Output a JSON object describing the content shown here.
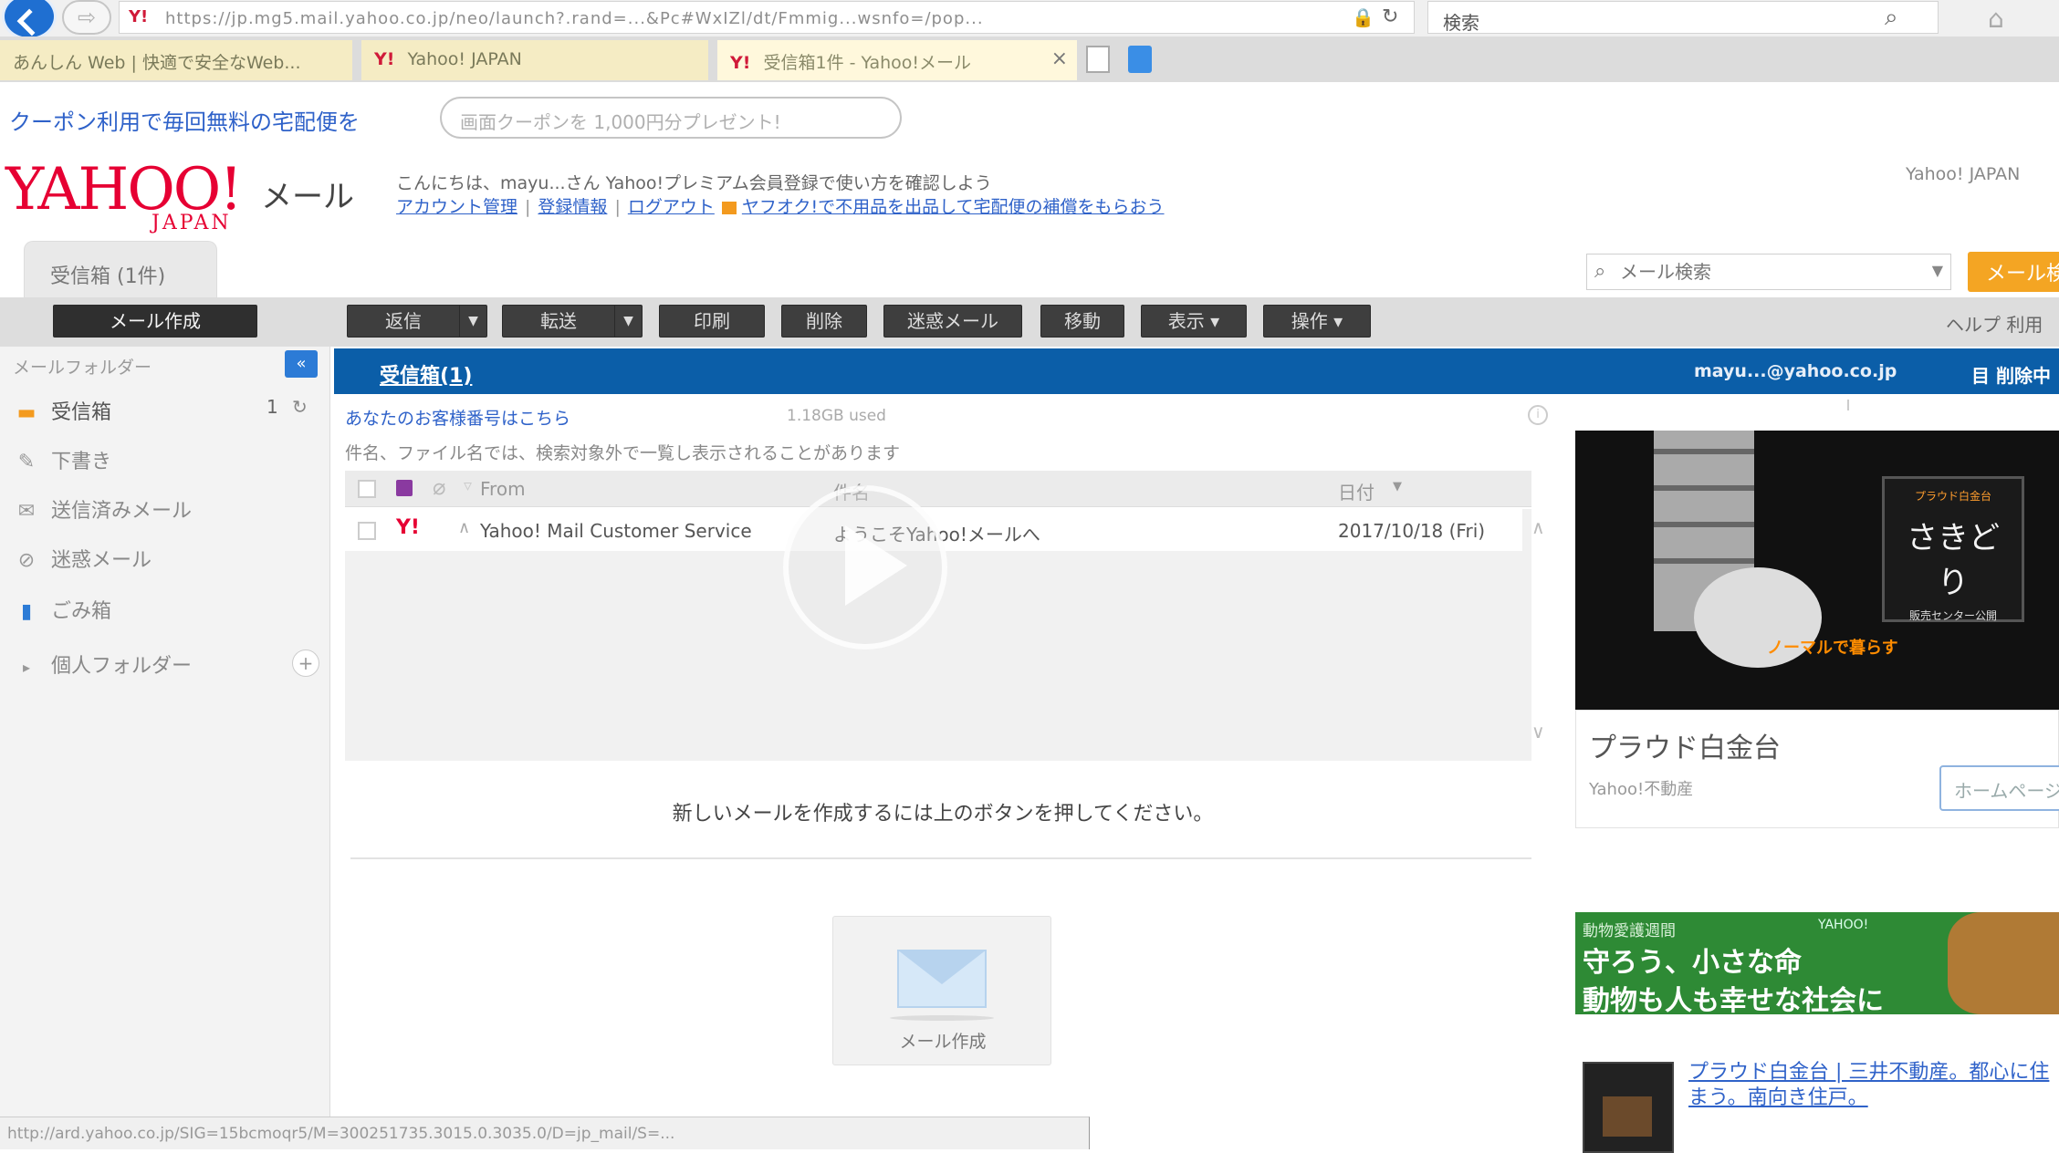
{
  "browser": {
    "back_icon": "back-arrow-icon",
    "forward_icon": "forward-arrow-icon",
    "forward_glyph": "⇨",
    "url_favicon": "Y!",
    "url": "https://jp.mg5.mail.yahoo.co.jp/neo/launch?.rand=...&Pc#WxIZl/dt/Fmmig...wsnfo=/pop...",
    "search_value": "検索",
    "search_icon": "magnifier-icon",
    "tabs": [
      {
        "label": "あんしん Web | 快適で安全なWeb..."
      },
      {
        "favicon": "Y!",
        "label": "Yahoo! JAPAN"
      },
      {
        "favicon": "Y!",
        "label": "受信箱1件 - Yahoo!メール"
      }
    ],
    "tab_close": "×"
  },
  "promo": {
    "link": "クーポン利用で毎回無料の宅配便を",
    "pill": "画面クーポンを 1,000円分プレゼント!"
  },
  "header": {
    "logo_main": "YAHOO!",
    "logo_sub": "JAPAN",
    "app_name": "メール",
    "greeting": "こんにちは、mayu...さん Yahoo!プレミアム会員登録で使い方を確認しよう",
    "links": [
      "アカウント管理",
      "登録情報",
      "ログアウト",
      "ヤフオク!で不用品を出品して宅配便の補償をもらおう"
    ],
    "yahoo_japan": "Yahoo! JAPAN"
  },
  "folder_tab": "受信箱 (1件)",
  "mail_search": {
    "placeholder": "メール検索",
    "button": "メール検索"
  },
  "toolbar": {
    "compose": "メール作成",
    "buttons": [
      "返信",
      "転送",
      "印刷",
      "削除",
      "迷惑メール",
      "移動",
      "表示",
      "操作"
    ],
    "right": "ヘルプ 利用"
  },
  "sidebar": {
    "header": "メールフォルダー",
    "collapse": "«",
    "items": [
      {
        "label": "受信箱",
        "icon": "inbox-icon",
        "glyph": "▬"
      },
      {
        "label": "下書き",
        "icon": "draft-icon",
        "glyph": "✎"
      },
      {
        "label": "送信済みメール",
        "icon": "sent-mail-icon",
        "glyph": "✉"
      },
      {
        "label": "迷惑メール",
        "icon": "spam-icon",
        "glyph": "⊘"
      },
      {
        "label": "ごみ箱",
        "icon": "trash-icon",
        "glyph": "▮"
      },
      {
        "label": "個人フォルダー",
        "icon": "folder-expand-icon",
        "glyph": "▸"
      }
    ],
    "inbox_count": "1",
    "refresh_glyph": "↻",
    "add_glyph": "+"
  },
  "main": {
    "title": "受信箱(1)",
    "account": "mayu...@yahoo.co.jp",
    "right": "目 削除中"
  },
  "list": {
    "notice1": "あなたのお客様番号はこちら",
    "notice1_size": "1.18GB used",
    "notice2": "件名、ファイル名では、検索対象外で一覧し表示されることがあります",
    "columns": {
      "from": "From",
      "subject": "件名",
      "date": "日付"
    },
    "rows": [
      {
        "from": "Yahoo! Mail Customer Service",
        "subject": "ようこそYahoo!メールへ",
        "date": "2017/10/18 (Fri)"
      }
    ],
    "empty_message": "新しいメールを作成するには上のボタンを押してください。",
    "compose_card_label": "メール作成"
  },
  "ads": {
    "video_caption": "ノーマルで暮らす",
    "video_box_top": "プラウド白金台",
    "video_box_main": "さきどり",
    "video_box_sub": "販売センター公開",
    "card_title": "プラウド白金台",
    "card_source": "Yahoo!不動産",
    "card_button": "ホームページへ",
    "banner_top": "動物愛護週間",
    "banner_logo": "YAHOO!",
    "banner_line1": "守ろう、小さな命",
    "banner_line2": "動物も人も幸せな社会に",
    "link_text": "プラウド白金台 | 三井不動産。都心に住まう。南向き住戸。"
  },
  "status_bar": "http://ard.yahoo.co.jp/SIG=15bcmoqr5/M=300251735.3015.0.3035.0/D=jp_mail/S=...",
  "colors": {
    "brand_red": "#e60033",
    "blue_bar": "#0b5ea8",
    "search_orange": "#f4a523",
    "link_blue": "#2f62c9"
  }
}
